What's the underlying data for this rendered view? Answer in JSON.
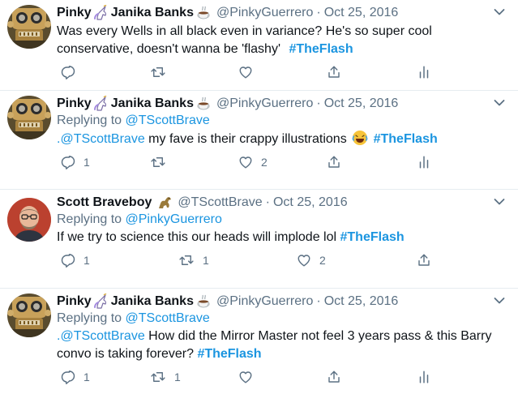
{
  "tweets": [
    {
      "name": "Pinky",
      "name2": "Janika Banks",
      "handle": "@PinkyGuerrero",
      "date": "Oct 25, 2016",
      "replying_label": "",
      "replying_to": "",
      "mention": "",
      "text": "Was every Wells in all black even in variance? He's so super cool conservative, doesn't wanna be 'flashy'",
      "hashtag": "#TheFlash",
      "replies": "",
      "retweets": "",
      "likes": ""
    },
    {
      "name": "Pinky",
      "name2": "Janika Banks",
      "handle": "@PinkyGuerrero",
      "date": "Oct 25, 2016",
      "replying_label": "Replying to",
      "replying_to": "@TScottBrave",
      "mention": ".@TScottBrave",
      "text": "my fave is their crappy illustrations",
      "hashtag": "#TheFlash",
      "replies": "1",
      "retweets": "",
      "likes": "2"
    },
    {
      "name": "Scott Braveboy",
      "handle": "@TScottBrave",
      "date": "Oct 25, 2016",
      "replying_label": "Replying to",
      "replying_to": "@PinkyGuerrero",
      "text": "If we try to science this our heads will implode lol",
      "hashtag": "#TheFlash",
      "replies": "1",
      "retweets": "1",
      "likes": "2"
    },
    {
      "name": "Pinky",
      "name2": "Janika Banks",
      "handle": "@PinkyGuerrero",
      "date": "Oct 25, 2016",
      "replying_label": "Replying to",
      "replying_to": "@TScottBrave",
      "mention": ".@TScottBrave",
      "text_line1": "How did the Mirror Master not feel 3 years pass & this Barry",
      "text_line2": "convo is taking forever?",
      "hashtag": "#TheFlash",
      "replies": "1",
      "retweets": "1",
      "likes": ""
    }
  ],
  "icons": [
    "unicorn-icon",
    "coffee-icon",
    "dinosaur-icon",
    "laughing-emoji-icon",
    "reply-icon",
    "retweet-icon",
    "like-icon",
    "share-icon",
    "analytics-icon",
    "more-icon"
  ],
  "colors": {
    "link": "#1b95e0",
    "muted": "#5b7083",
    "divider": "#e6ecf0"
  }
}
